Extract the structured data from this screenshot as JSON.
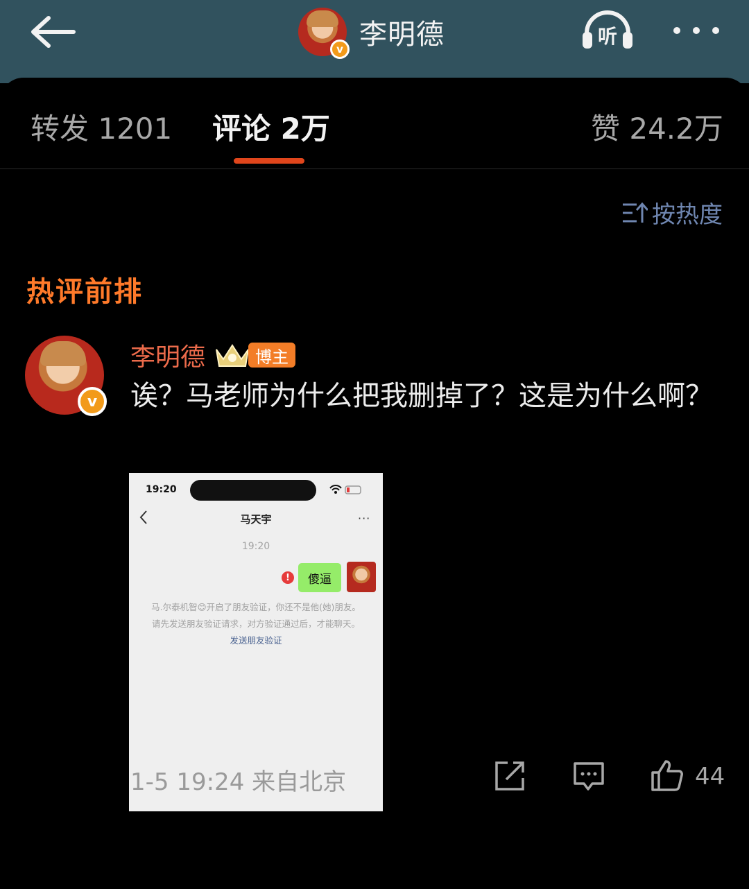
{
  "header": {
    "title": "李明德",
    "listen_label": "听",
    "verified_mark": "v"
  },
  "tabs": [
    {
      "label": "转发 1201",
      "active": false
    },
    {
      "label": "评论 2万",
      "active": true
    },
    {
      "label": "赞 24.2万",
      "active": false
    }
  ],
  "sort": {
    "label": "按热度"
  },
  "section_title": "热评前排",
  "comment": {
    "author": "李明德",
    "author_badge": "博主",
    "verified_mark": "v",
    "text": "诶？马老师为什么把我删掉了？这是为什么啊？",
    "date_location": "1-5 19:24 来自北京",
    "like_count": "44"
  },
  "screenshot": {
    "time": "19:20",
    "chat_title": "马天宇",
    "more": "···",
    "timestamp": "19:20",
    "warning": "!",
    "message": "傻逼",
    "notice_text": "马.尔泰机智😊开启了朋友验证，你还不是他(她)朋友。请先发送朋友验证请求，对方验证通过后，才能聊天。",
    "notice_link": "发送朋友验证"
  },
  "colors": {
    "topbar": "#31525e",
    "accent_orange": "#ff7a2a",
    "tab_underline": "#e0461c",
    "sort_blue": "#6f86b0",
    "author_name": "#ec6b4b"
  },
  "icons": [
    "back-arrow-icon",
    "headphones-icon",
    "more-dots-icon",
    "sort-icon",
    "crown-icon",
    "share-icon",
    "comment-icon",
    "like-icon"
  ]
}
